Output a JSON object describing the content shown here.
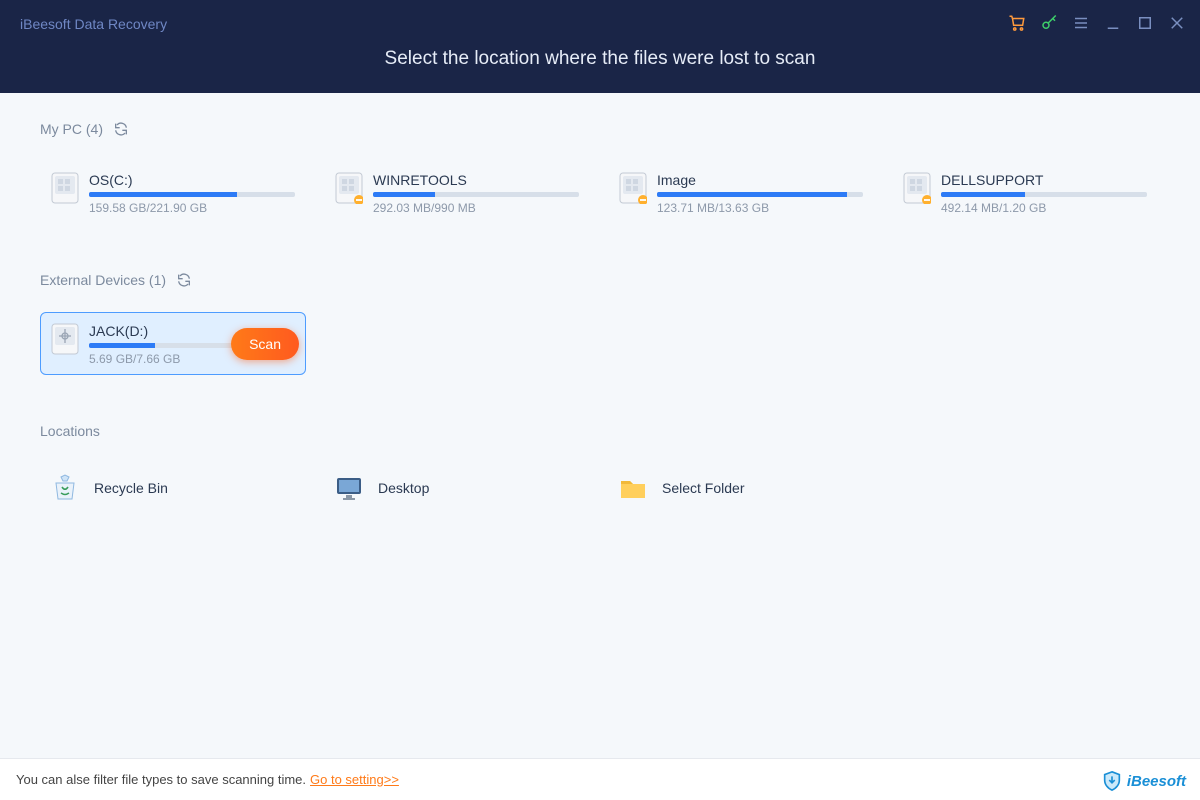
{
  "app_title": "iBeesoft Data Recovery",
  "heading": "Select the location where the files were lost to scan",
  "sections": {
    "my_pc": {
      "label": "My PC (4)"
    },
    "external": {
      "label": "External Devices (1)"
    },
    "locations": {
      "label": "Locations"
    }
  },
  "pc_drives": [
    {
      "name": "OS(C:)",
      "used": "159.58 GB",
      "total": "221.90 GB",
      "pct": 72,
      "badge": false
    },
    {
      "name": "WINRETOOLS",
      "used": "292.03 MB",
      "total": "990 MB",
      "pct": 30,
      "badge": true
    },
    {
      "name": "Image",
      "used": "123.71 MB",
      "total": "13.63 GB",
      "pct": 92,
      "badge": true
    },
    {
      "name": "DELLSUPPORT",
      "used": "492.14 MB",
      "total": "1.20 GB",
      "pct": 41,
      "badge": true
    }
  ],
  "ext_drives": [
    {
      "name": "JACK(D:)",
      "used": "5.69 GB",
      "total": "7.66 GB",
      "pct": 32,
      "usb": true,
      "selected": true
    }
  ],
  "scan_label": "Scan",
  "locations": [
    {
      "name": "Recycle Bin",
      "icon": "recycle"
    },
    {
      "name": "Desktop",
      "icon": "desktop"
    },
    {
      "name": "Select Folder",
      "icon": "folder"
    }
  ],
  "footer": {
    "text": "You can alse filter file types to save scanning time.",
    "link": "Go to setting>>"
  },
  "brand": "iBeesoft"
}
